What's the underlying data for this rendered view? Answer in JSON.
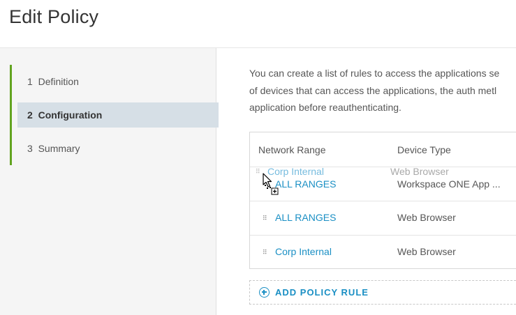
{
  "page": {
    "title": "Edit Policy"
  },
  "wizard": {
    "steps": [
      {
        "number": "1",
        "label": "Definition",
        "active": false
      },
      {
        "number": "2",
        "label": "Configuration",
        "active": true
      },
      {
        "number": "3",
        "label": "Summary",
        "active": false
      }
    ],
    "accent_color": "#62a420"
  },
  "description": {
    "lines": [
      "You can create a list of rules to access the applications se",
      "of devices that can access the applications, the auth metl",
      "application before reauthenticating."
    ]
  },
  "rules_table": {
    "columns": [
      "Network Range",
      "Device Type"
    ],
    "rows": [
      {
        "network_range": "ALL RANGES",
        "device_type": "Workspace ONE App ..."
      },
      {
        "network_range": "ALL RANGES",
        "device_type": "Web Browser"
      },
      {
        "network_range": "Corp Internal",
        "device_type": "Web Browser"
      }
    ],
    "dragging_row": {
      "network_range": "Corp Internal",
      "device_type": "Web Browser"
    }
  },
  "actions": {
    "add_rule_label": "ADD POLICY RULE"
  },
  "colors": {
    "link": "#1a8fc4",
    "active_step_bg": "#d6dfe6"
  }
}
